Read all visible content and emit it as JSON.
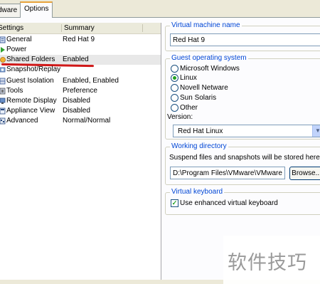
{
  "tabs": [
    {
      "label": "dware",
      "active": false
    },
    {
      "label": "Options",
      "active": true
    }
  ],
  "settings_list": {
    "headers": {
      "settings": "Settings",
      "summary": "Summary"
    },
    "rows": [
      {
        "name": "General",
        "summary": "Red Hat 9",
        "icon": "general-icon"
      },
      {
        "name": "Power",
        "summary": "",
        "icon": "power-icon"
      },
      {
        "name": "Shared Folders",
        "summary": "Enabled",
        "icon": "shared-folders-icon"
      },
      {
        "name": "Snapshot/Replay",
        "summary": "",
        "icon": "snapshot-icon"
      },
      {
        "name": "Guest Isolation",
        "summary": "Enabled, Enabled",
        "icon": "guest-isolation-icon"
      },
      {
        "name": "Tools",
        "summary": "Preference",
        "icon": "tools-icon"
      },
      {
        "name": "Remote Display",
        "summary": "Disabled",
        "icon": "remote-display-icon"
      },
      {
        "name": "Appliance View",
        "summary": "Disabled",
        "icon": "appliance-view-icon"
      },
      {
        "name": "Advanced",
        "summary": "Normal/Normal",
        "icon": "advanced-icon"
      }
    ]
  },
  "vm_name": {
    "legend": "Virtual machine name",
    "value": "Red Hat 9"
  },
  "guest_os": {
    "legend": "Guest operating system",
    "options": [
      {
        "label": "Microsoft Windows",
        "selected": false
      },
      {
        "label": "Linux",
        "selected": true
      },
      {
        "label": "Novell Netware",
        "selected": false
      },
      {
        "label": "Sun Solaris",
        "selected": false
      },
      {
        "label": "Other",
        "selected": false
      }
    ],
    "version_label": "Version:",
    "version_value": "Red Hat Linux"
  },
  "working_dir": {
    "legend": "Working directory",
    "description": "Suspend files and snapshots will be stored here.",
    "path": "D:\\Program Files\\VMware\\VMware W",
    "browse_label": "Browse..."
  },
  "keyboard": {
    "legend": "Virtual keyboard",
    "checkbox_label": "Use enhanced virtual keyboard",
    "checked": true
  },
  "watermark": "软件技巧",
  "colors": {
    "accent": "#0046d5",
    "annotation": "#d01818",
    "radio_selected": "#21a121"
  }
}
